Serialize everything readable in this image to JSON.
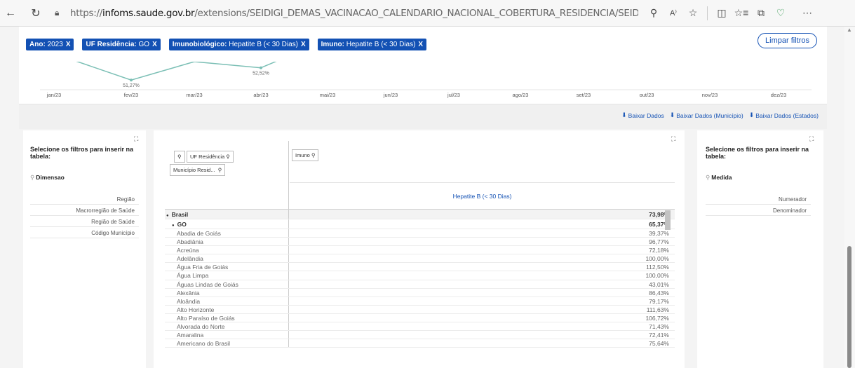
{
  "browser": {
    "url_host_prefix": "https://",
    "url_host": "infoms.saude.gov.br",
    "url_path": "/extensions/SEIDIGI_DEMAS_VACINACAO_CALENDARIO_NACIONAL_COBERTURA_RESIDENCIA/SEIDIGI_DEMAS_VACINACAO_CALEN...",
    "icons": [
      "back-icon",
      "reload-icon",
      "lock-icon",
      "zoom-icon",
      "read-aloud-icon",
      "star-icon",
      "split-screen-icon",
      "favorites-icon",
      "collections-icon",
      "extension-icon",
      "more-icon"
    ]
  },
  "filters": {
    "chips": [
      {
        "key": "Ano:",
        "value": "2023",
        "x": "X"
      },
      {
        "key": "UF Residência:",
        "value": "GO",
        "x": "X"
      },
      {
        "key": "Imunobiológico:",
        "value": "Hepatite B (< 30 Dias)",
        "x": "X"
      },
      {
        "key": "Imuno:",
        "value": "Hepatite B (< 30 Dias)",
        "x": "X"
      }
    ],
    "clear_label": "Limpar filtros"
  },
  "chart_data": {
    "type": "line",
    "categories": [
      "jan/23",
      "fev/23",
      "mar/23",
      "abr/23",
      "mai/23",
      "jun/23",
      "jul/23",
      "ago/23",
      "set/23",
      "out/23",
      "nov/23",
      "dez/23"
    ],
    "series": [
      {
        "values": [
          null,
          51.27,
          null,
          52.52,
          null,
          null,
          null,
          null,
          null,
          null,
          null,
          null
        ]
      }
    ],
    "data_labels": [
      "51,27%",
      "52,52%"
    ],
    "line_color": "#7bbfb5"
  },
  "downloads": {
    "dl1": "Baixar Dados",
    "dl2": "Baixar Dados (Município)",
    "dl3": "Baixar Dados (Estados)"
  },
  "left_panel": {
    "title": "Selecione os filtros para inserir na tabela:",
    "search_label": "Dimensao",
    "items": [
      "Região",
      "Macrorregião de Saúde",
      "Região de Saúde",
      "Código Município"
    ]
  },
  "right_panel": {
    "title": "Selecione os filtros para inserir na tabela:",
    "search_label": "Medida",
    "items": [
      "Numerador",
      "Denominador"
    ]
  },
  "pivot": {
    "row_dim_uf": "UF Residência",
    "row_dim_mun": "Município Resid...",
    "col_dim": "Imuno",
    "col_header": "Hepatite B (< 30 Dias)",
    "rows": [
      {
        "level": 0,
        "label": "Brasil",
        "value": "73,98%"
      },
      {
        "level": 1,
        "label": "GO",
        "value": "65,37%"
      },
      {
        "level": 2,
        "label": "Abadia de Goiás",
        "value": "39,37%"
      },
      {
        "level": 2,
        "label": "Abadiânia",
        "value": "96,77%"
      },
      {
        "level": 2,
        "label": "Acreúna",
        "value": "72,18%"
      },
      {
        "level": 2,
        "label": "Adelândia",
        "value": "100,00%"
      },
      {
        "level": 2,
        "label": "Água Fria de Goiás",
        "value": "112,50%"
      },
      {
        "level": 2,
        "label": "Água Limpa",
        "value": "100,00%"
      },
      {
        "level": 2,
        "label": "Águas Lindas de Goiás",
        "value": "43,01%"
      },
      {
        "level": 2,
        "label": "Alexânia",
        "value": "86,43%"
      },
      {
        "level": 2,
        "label": "Aloândia",
        "value": "79,17%"
      },
      {
        "level": 2,
        "label": "Alto Horizonte",
        "value": "111,63%"
      },
      {
        "level": 2,
        "label": "Alto Paraíso de Goiás",
        "value": "106,72%"
      },
      {
        "level": 2,
        "label": "Alvorada do Norte",
        "value": "71,43%"
      },
      {
        "level": 2,
        "label": "Amaralina",
        "value": "72,41%"
      },
      {
        "level": 2,
        "label": "Americano do Brasil",
        "value": "75,64%"
      }
    ]
  }
}
